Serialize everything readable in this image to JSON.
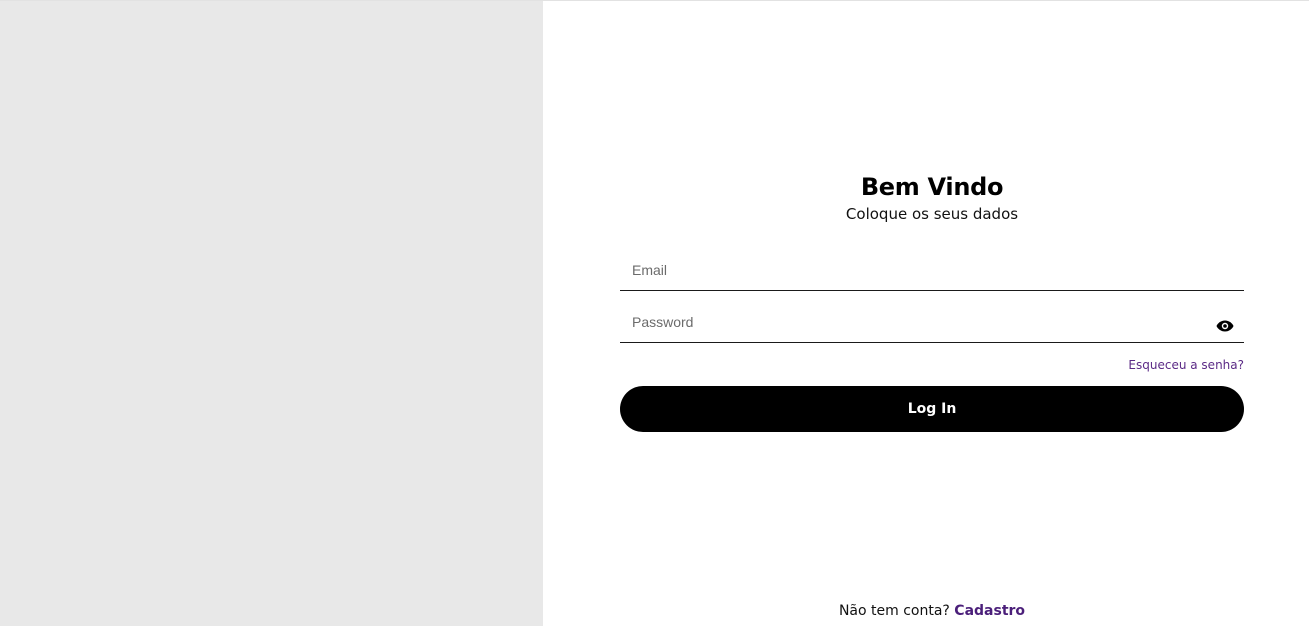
{
  "header": {
    "title": "Bem Vindo",
    "subtitle": "Coloque os seus dados"
  },
  "form": {
    "email_placeholder": "Email",
    "email_value": "",
    "password_placeholder": "Password",
    "password_value": "",
    "forgot_label": "Esqueceu a senha?",
    "login_label": "Log In"
  },
  "footer": {
    "prompt": "Não tem conta?",
    "signup_label": "Cadastro"
  },
  "icons": {
    "password_toggle": "eye-icon"
  },
  "colors": {
    "left_panel": "#e8e8e8",
    "button": "#000000",
    "link": "#5b2a86"
  }
}
